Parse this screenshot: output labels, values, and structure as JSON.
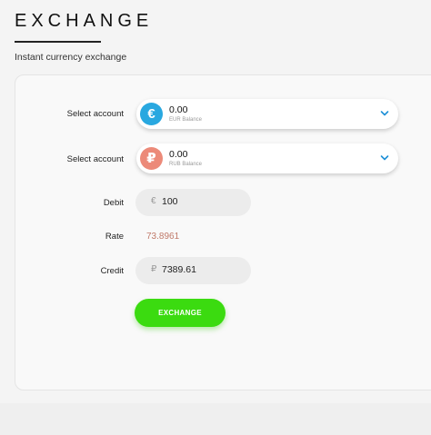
{
  "header": {
    "title": "EXCHANGE",
    "subtitle": "Instant currency exchange"
  },
  "accounts": [
    {
      "label": "Select account",
      "amount": "0.00",
      "balance_label": "EUR Balance",
      "currency_symbol": "€",
      "icon": "euro-icon",
      "color": "#29a8e0"
    },
    {
      "label": "Select account",
      "amount": "0.00",
      "balance_label": "RUB Balance",
      "currency_symbol": "₽",
      "icon": "ruble-icon",
      "color": "#ec8a79"
    }
  ],
  "debit": {
    "label": "Debit",
    "symbol": "€",
    "value": "100"
  },
  "rate": {
    "label": "Rate",
    "value": "73.8961"
  },
  "credit": {
    "label": "Credit",
    "symbol": "₽",
    "value": "7389.61"
  },
  "action": {
    "label": "EXCHANGE",
    "color": "#3bdb10"
  },
  "colors": {
    "accent_chevron": "#1e90d6"
  }
}
